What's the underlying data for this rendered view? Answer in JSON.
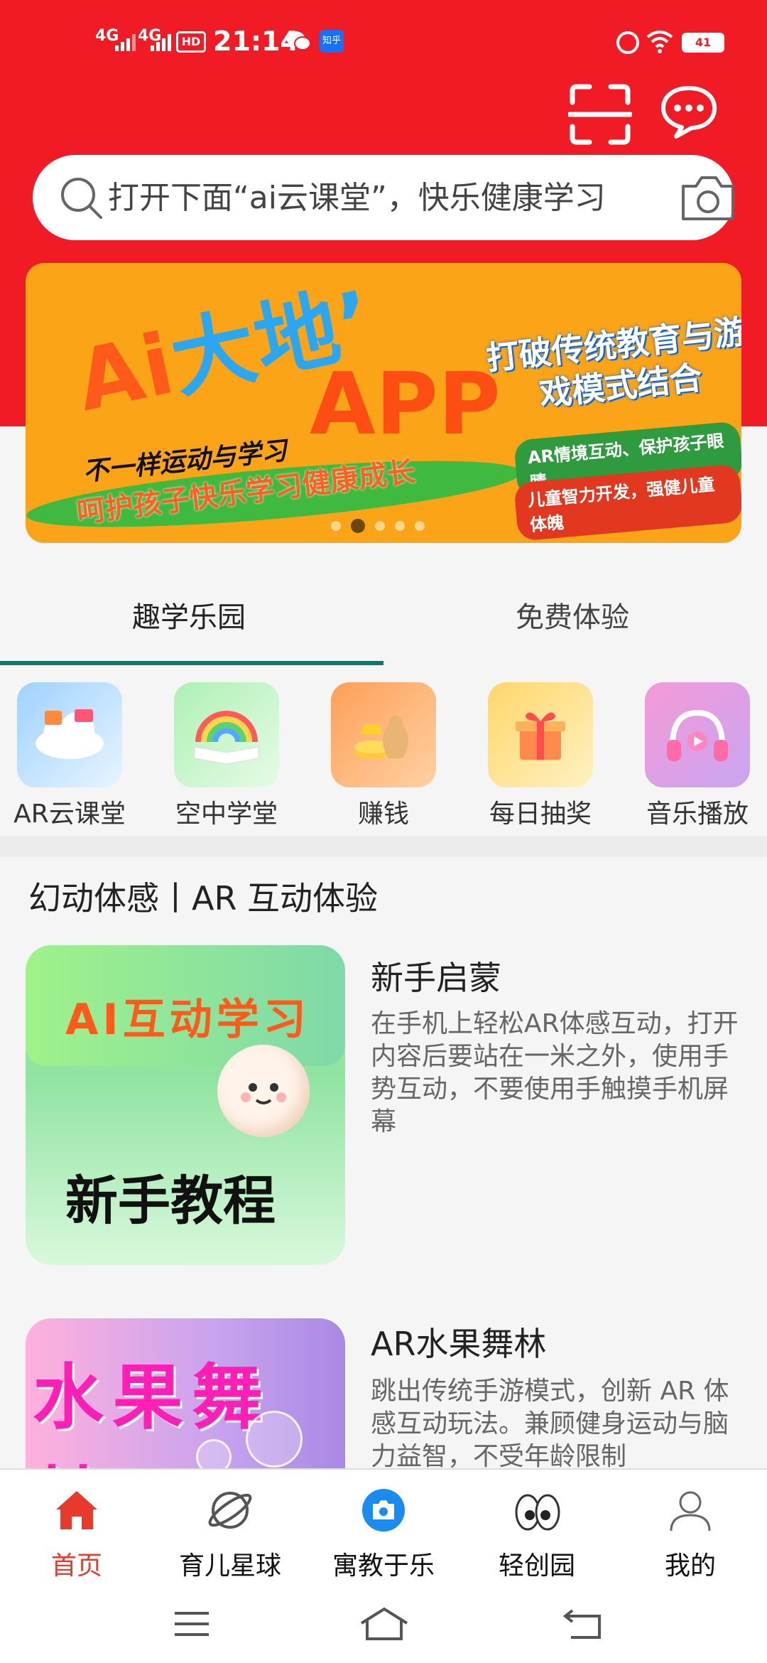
{
  "status_bar": {
    "signal1": "4G",
    "signal2": "4G",
    "hd_label": "HD",
    "time": "21:14",
    "zhihu_label": "知乎",
    "battery": "41"
  },
  "search": {
    "placeholder": "打开下面“ai云课堂”，快乐健康学习"
  },
  "banner": {
    "brand_part1": "Ai",
    "brand_part2": "大地’",
    "app": "APP",
    "subtitle1": "不一样运动与学习",
    "subtitle2": "呵护孩子快乐学习健康成长",
    "right_title": "打破传统教育与游戏模式结合",
    "pill1": "AR情境互动、保护孩子眼睛",
    "pill2": "儿童智力开发，强健儿童体魄",
    "total_slides": 5,
    "active_slide": 2
  },
  "tabs": [
    {
      "label": "趣学乐园",
      "active": true
    },
    {
      "label": "免费体验",
      "active": false
    }
  ],
  "grid_items": [
    {
      "label": "AR云课堂",
      "icon": "cloud-icon",
      "glyph": "☁",
      "bg": "#bfe3ff"
    },
    {
      "label": "空中学堂",
      "icon": "rainbow-book-icon",
      "glyph": "🌈",
      "bg": "#c7f3c7"
    },
    {
      "label": "赚钱",
      "icon": "money-bag-icon",
      "glyph": "💰",
      "bg": "#ffbf7a"
    },
    {
      "label": "每日抽奖",
      "icon": "gift-box-icon",
      "glyph": "🎁",
      "bg": "#ffe09a"
    },
    {
      "label": "音乐播放",
      "icon": "headphones-icon",
      "glyph": "🎧",
      "bg": "#e9b6f7"
    }
  ],
  "section_title": "幻动体感丨AR 互动体验",
  "cards": [
    {
      "title": "新手启蒙",
      "desc": "在手机上轻松AR体感互动，打开内容后要站在一米之外，使用手势互动，不要使用手触摸手机屏幕",
      "thumb_line1": "AI互动学习",
      "thumb_line2": "新手教程"
    },
    {
      "title": "AR水果舞林",
      "desc": "跳出传统手游模式，创新 AR 体感互动玩法。兼顾健身运动与脑力益智，不受年龄限制",
      "thumb_line1": "水果舞林"
    }
  ],
  "bottom_nav": [
    {
      "label": "首页",
      "icon": "home-icon",
      "active": true
    },
    {
      "label": "育儿星球",
      "icon": "planet-icon",
      "active": false
    },
    {
      "label": "寓教于乐",
      "icon": "camera-icon",
      "active": false
    },
    {
      "label": "轻创园",
      "icon": "eyes-icon",
      "active": false
    },
    {
      "label": "我的",
      "icon": "user-icon",
      "active": false
    }
  ],
  "colors": {
    "brand_red": "#f01b24",
    "tab_underline": "#0f7a6c",
    "active_nav": "#e83a2a"
  }
}
